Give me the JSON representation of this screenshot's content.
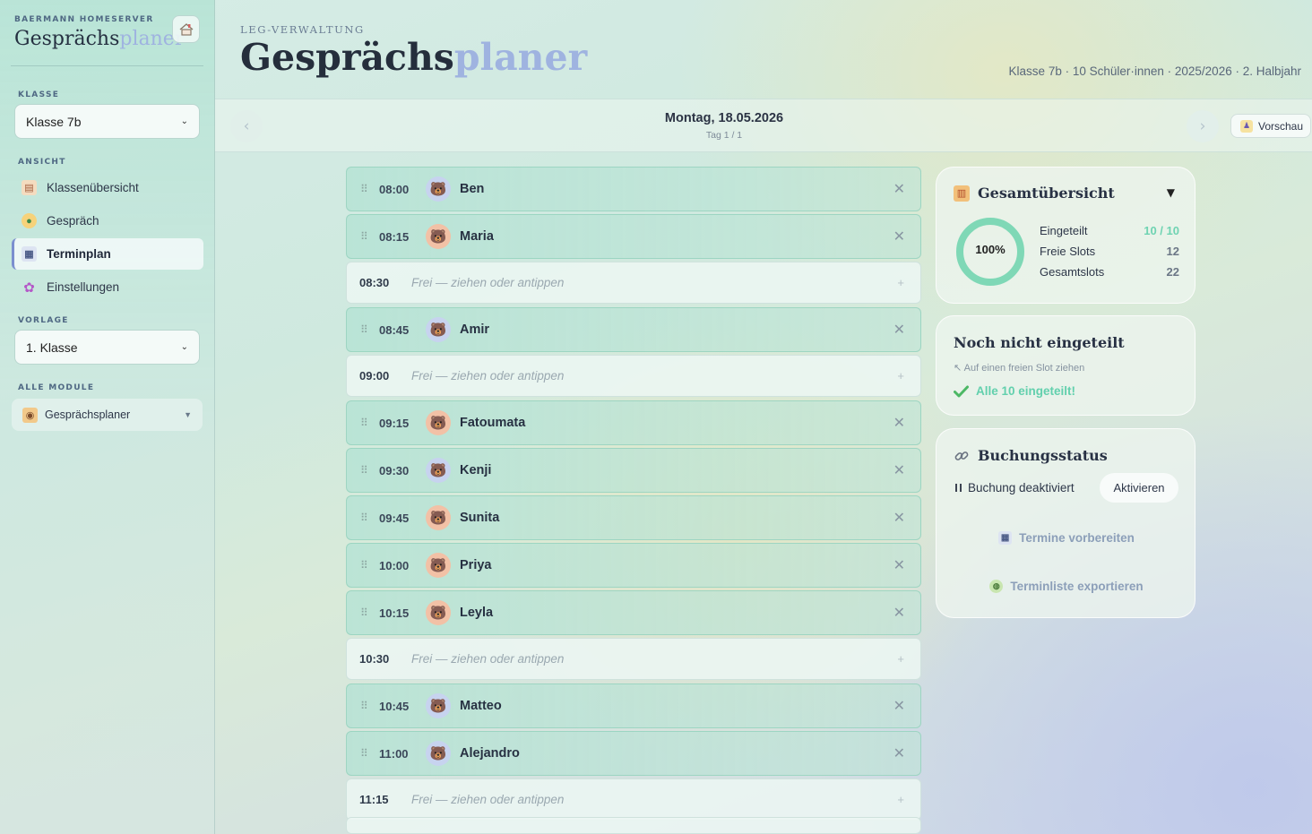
{
  "sidebar": {
    "kicker": "BAERMANN HOMESERVER",
    "title_main": "Gesprächs",
    "title_accent": "planer",
    "klasse_label": "KLASSE",
    "klasse_value": "Klasse 7b",
    "ansicht_label": "ANSICHT",
    "nav": [
      {
        "label": "Klassenübersicht",
        "icon": "clipboard-icon"
      },
      {
        "label": "Gespräch",
        "icon": "chat-icon"
      },
      {
        "label": "Terminplan",
        "icon": "calendar-icon",
        "active": true
      },
      {
        "label": "Einstellungen",
        "icon": "gear-icon"
      }
    ],
    "vorlage_label": "VORLAGE",
    "vorlage_value": "1. Klasse",
    "module_label": "ALLE MODULE",
    "module_value": "Gesprächsplaner"
  },
  "header": {
    "kicker": "LEG-VERWALTUNG",
    "title_main": "Gesprächs",
    "title_accent": "planer",
    "meta": "Klasse 7b · 10 Schüler·innen · 2025/2026 · 2. Halbjahr"
  },
  "daybar": {
    "prev": "‹",
    "next": "›",
    "date": "Montag, 18.05.2026",
    "sub": "Tag 1 / 1",
    "preview": "Vorschau"
  },
  "slots": [
    {
      "time": "08:00",
      "name": "Ben",
      "avatar": "blue"
    },
    {
      "time": "08:15",
      "name": "Maria",
      "avatar": "warm"
    },
    {
      "time": "08:30",
      "free": "Frei — ziehen oder antippen"
    },
    {
      "time": "08:45",
      "name": "Amir",
      "avatar": "blue"
    },
    {
      "time": "09:00",
      "free": "Frei — ziehen oder antippen"
    },
    {
      "time": "09:15",
      "name": "Fatoumata",
      "avatar": "warm"
    },
    {
      "time": "09:30",
      "name": "Kenji",
      "avatar": "blue"
    },
    {
      "time": "09:45",
      "name": "Sunita",
      "avatar": "warm"
    },
    {
      "time": "10:00",
      "name": "Priya",
      "avatar": "warm"
    },
    {
      "time": "10:15",
      "name": "Leyla",
      "avatar": "warm"
    },
    {
      "time": "10:30",
      "free": "Frei — ziehen oder antippen"
    },
    {
      "time": "10:45",
      "name": "Matteo",
      "avatar": "blue"
    },
    {
      "time": "11:00",
      "name": "Alejandro",
      "avatar": "blue"
    },
    {
      "time": "11:15",
      "free": "Frei — ziehen oder antippen"
    }
  ],
  "overview": {
    "title": "Gesamtübersicht",
    "toggle": "▼",
    "percent": "100%",
    "fill_fraction": 1.0,
    "rows": [
      {
        "label": "Eingeteilt",
        "value": "10 / 10"
      },
      {
        "label": "Freie Slots",
        "value": "12"
      },
      {
        "label": "Gesamtslots",
        "value": "22"
      }
    ]
  },
  "unassigned": {
    "title": "Noch nicht eingeteilt",
    "hint": "↖ Auf einen freien Slot ziehen",
    "done": "Alle 10 eingeteilt!"
  },
  "booking": {
    "title": "Buchungsstatus",
    "status": "Buchung deaktiviert",
    "activate": "Aktivieren",
    "prepare": "Termine vorbereiten",
    "export": "Terminliste exportieren"
  },
  "colors": {
    "accent": "#9fb3e0",
    "success": "#62d0ad",
    "donut": "#7fd8b6"
  }
}
